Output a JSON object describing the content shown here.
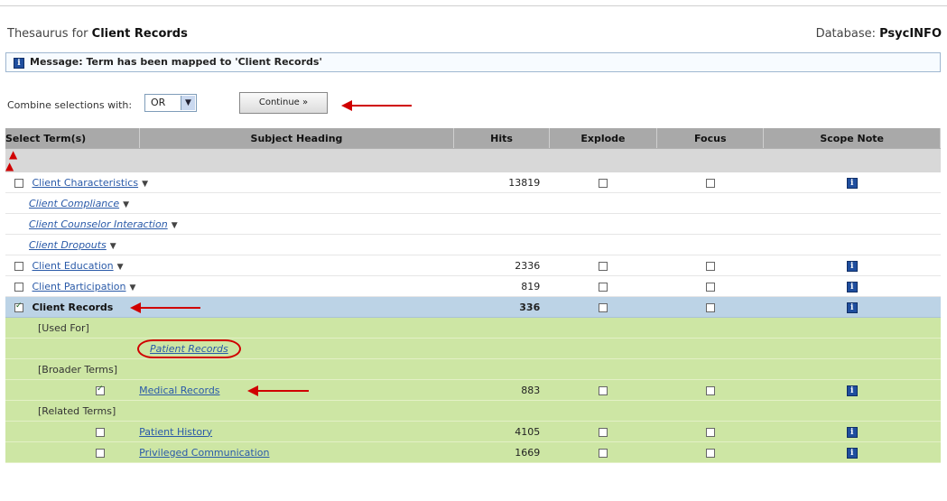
{
  "header": {
    "title_prefix": "Thesaurus for ",
    "title_term": "Client Records",
    "db_label": "Database: ",
    "db_name": "PsycINFO"
  },
  "message": {
    "icon": "info-icon",
    "text": "Message: Term has been mapped to 'Client Records'"
  },
  "combine": {
    "label": "Combine selections with:",
    "value": "OR",
    "continue_label": "Continue »"
  },
  "table": {
    "headers": [
      "Select Term(s)",
      "Subject Heading",
      "Hits",
      "Explode",
      "Focus",
      "Scope Note"
    ],
    "top_rows": [
      {
        "term": "Client Characteristics",
        "hits": "13819",
        "checkbox": true,
        "scope": true,
        "italic": false
      },
      {
        "term": "Client Compliance",
        "hits": "",
        "checkbox": false,
        "scope": false,
        "italic": true
      },
      {
        "term": "Client Counselor Interaction",
        "hits": "",
        "checkbox": false,
        "scope": false,
        "italic": true
      },
      {
        "term": "Client Dropouts",
        "hits": "",
        "checkbox": false,
        "scope": false,
        "italic": true
      },
      {
        "term": "Client Education",
        "hits": "2336",
        "checkbox": true,
        "scope": true,
        "italic": false
      },
      {
        "term": "Client Participation",
        "hits": "819",
        "checkbox": true,
        "scope": true,
        "italic": false
      }
    ],
    "selected_row": {
      "term": "Client Records",
      "hits": "336"
    },
    "used_for_label": "[Used For]",
    "used_for_term": "Patient Records",
    "broader_label": "[Broader Terms]",
    "broader_row": {
      "term": "Medical Records",
      "hits": "883"
    },
    "related_label": "[Related Terms]",
    "related_rows": [
      {
        "term": "Patient History",
        "hits": "4105"
      },
      {
        "term": "Privileged Communication",
        "hits": "1669"
      }
    ]
  },
  "colors": {
    "accent": "#d00000",
    "link": "#2a5aa8",
    "green_row": "#cde6a4",
    "selected_row": "#bcd3e6"
  }
}
